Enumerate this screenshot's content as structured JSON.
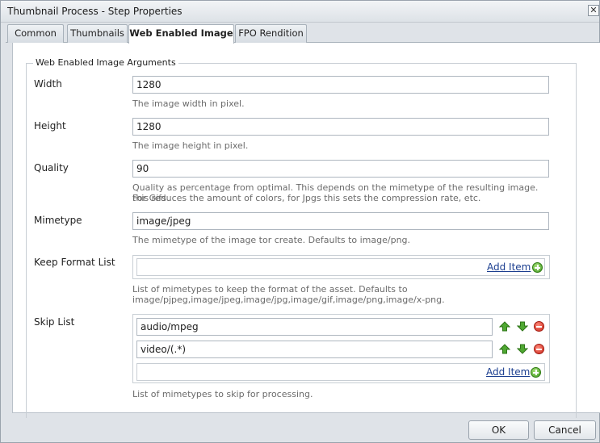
{
  "window": {
    "title": "Thumbnail Process - Step Properties",
    "close_glyph": "✕"
  },
  "tabs": [
    {
      "label": "Common"
    },
    {
      "label": "Thumbnails"
    },
    {
      "label": "Web Enabled Image",
      "active": true
    },
    {
      "label": "FPO Rendition"
    }
  ],
  "fieldset": {
    "legend": "Web Enabled Image Arguments"
  },
  "fields": {
    "width": {
      "label": "Width",
      "value": "1280",
      "hint": "The image width in pixel."
    },
    "height": {
      "label": "Height",
      "value": "1280",
      "hint": "The image height in pixel."
    },
    "quality": {
      "label": "Quality",
      "value": "90",
      "hint_line1": "Quality as percentage from optimal. This depends on the mimetype of the resulting image. For Gifs",
      "hint_line2": "this reduces the amount of colors, for Jpgs this sets the compression rate, etc."
    },
    "mimetype": {
      "label": "Mimetype",
      "value": "image/jpeg",
      "hint": "The mimetype of the image tor create. Defaults to image/png."
    }
  },
  "keep_format_list": {
    "label": "Keep Format List",
    "add_label": "Add Item",
    "hint_line1": "List of mimetypes to keep the format of the asset. Defaults to",
    "hint_line2": "image/pjpeg,image/jpeg,image/jpg,image/gif,image/png,image/x-png."
  },
  "skip_list": {
    "label": "Skip List",
    "items": [
      "audio/mpeg",
      "video/(.*)"
    ],
    "add_label": "Add Item",
    "hint": "List of mimetypes to skip for processing."
  },
  "buttons": {
    "ok": "OK",
    "cancel": "Cancel"
  },
  "colors": {
    "accent_link": "#1a3d8f",
    "add_green": "#3f9a1f",
    "remove_red": "#c9271b"
  },
  "icons": [
    "close-icon",
    "add-item-icon",
    "move-up-icon",
    "move-down-icon",
    "remove-item-icon"
  ]
}
